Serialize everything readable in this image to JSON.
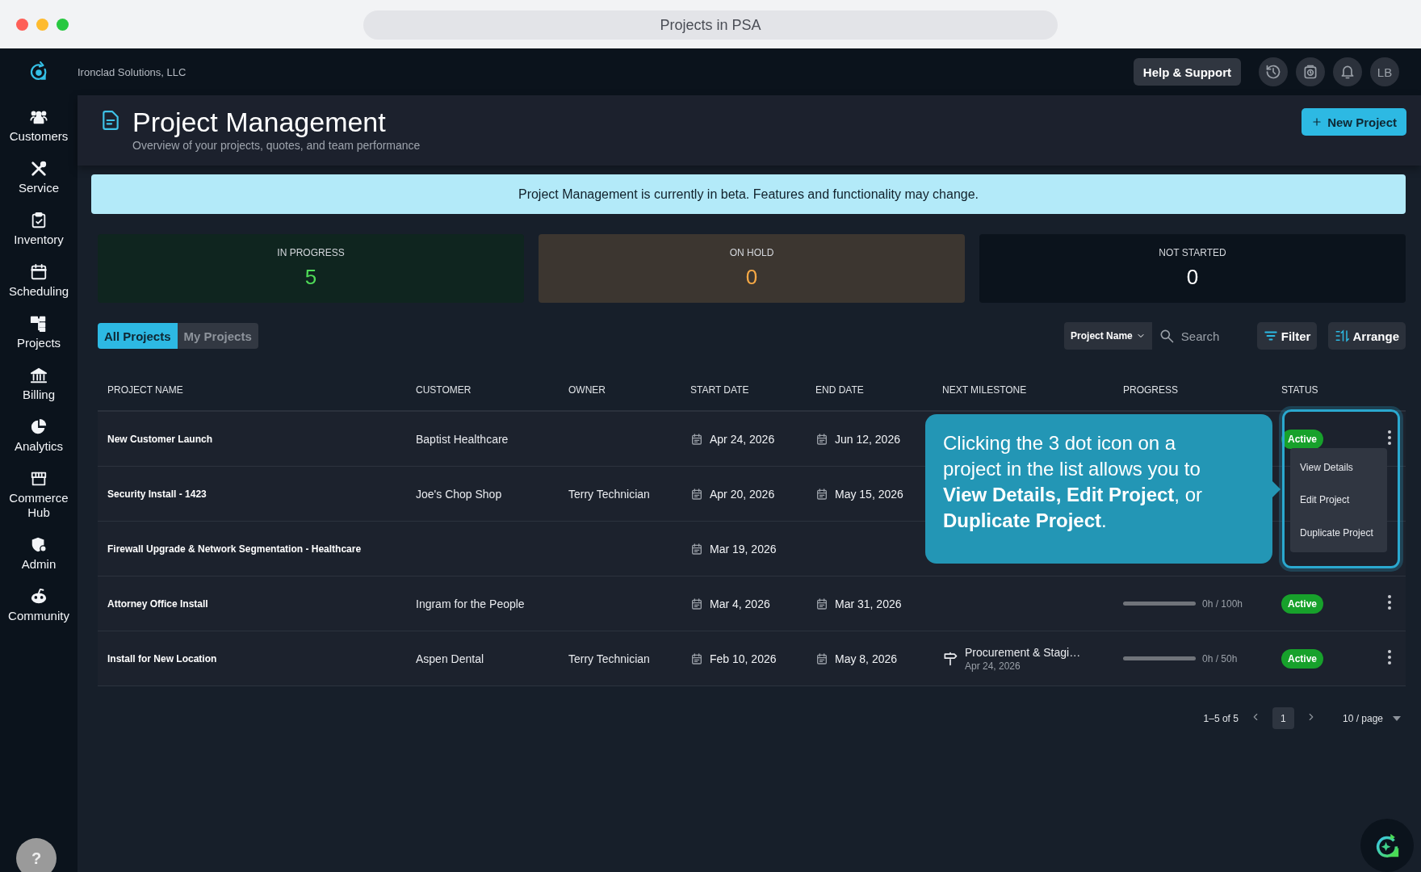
{
  "window": {
    "title": "Projects in PSA"
  },
  "company": "Ironclad Solutions, LLC",
  "top_actions": {
    "help": "Help & Support",
    "avatar": "LB"
  },
  "sidebar": {
    "items": [
      {
        "label": "Customers",
        "selected": false
      },
      {
        "label": "Service",
        "selected": false
      },
      {
        "label": "Inventory",
        "selected": false
      },
      {
        "label": "Scheduling",
        "selected": false
      },
      {
        "label": "Projects",
        "selected": false
      },
      {
        "label": "Billing",
        "selected": false
      },
      {
        "label": "Analytics",
        "selected": false
      },
      {
        "label": "Commerce Hub",
        "selected": false
      },
      {
        "label": "Admin",
        "selected": false
      },
      {
        "label": "Community",
        "selected": false
      }
    ]
  },
  "header": {
    "title": "Project Management",
    "subtitle": "Overview of your projects, quotes, and team performance",
    "new_button": "New Project"
  },
  "banner": "Project Management is currently in beta. Features and functionality may change.",
  "stats": [
    {
      "kind": "progress",
      "label": "IN PROGRESS",
      "value": "5"
    },
    {
      "kind": "hold",
      "label": "ON HOLD",
      "value": "0"
    },
    {
      "kind": "idle",
      "label": "NOT STARTED",
      "value": "0"
    }
  ],
  "tabs": [
    {
      "label": "All Projects",
      "selected": true
    },
    {
      "label": "My Projects",
      "selected": false
    }
  ],
  "toolbar": {
    "field_select": "Project Name",
    "search_placeholder": "Search",
    "filter": "Filter",
    "arrange": "Arrange"
  },
  "table": {
    "columns": [
      "PROJECT NAME",
      "CUSTOMER",
      "OWNER",
      "START DATE",
      "END DATE",
      "NEXT MILESTONE",
      "PROGRESS",
      "STATUS"
    ],
    "rows": [
      {
        "name": "New Customer Launch",
        "customer": "Baptist Healthcare",
        "start": "Apr 24, 2026",
        "end": "Jun 12, 2026",
        "status": "Active"
      },
      {
        "name": "Security Install - 1423",
        "customer": "Joe's Chop Shop",
        "owner": "Terry Technician",
        "start": "Apr 20, 2026",
        "end": "May 15, 2026"
      },
      {
        "name": "Firewall Upgrade & Network Segmentation - Healthcare",
        "start": "Mar 19, 2026"
      },
      {
        "name": "Attorney Office Install",
        "customer": "Ingram for the People",
        "start": "Mar 4, 2026",
        "end": "Mar 31, 2026",
        "progress": {
          "level": 0,
          "reading": "0h / 100h"
        },
        "status": "Active"
      },
      {
        "name": "Install for New Location",
        "customer": "Aspen Dental",
        "owner": "Terry Technician",
        "start": "Feb 10, 2026",
        "end": "May 8, 2026",
        "milestone": {
          "title": "Procurement & Stagi…",
          "date": "Apr 24, 2026"
        },
        "progress": {
          "level": 0,
          "reading": "0h / 50h"
        },
        "status": "Active"
      }
    ]
  },
  "tooltip": "Clicking the 3 dot icon on a project in the list allows you to **View Details, Edit Project**, or **Duplicate Project**.",
  "row_menu": {
    "items": [
      "View Details",
      "Edit Project",
      "Duplicate Project"
    ]
  },
  "pagination": {
    "range": "1–5 of 5",
    "pages": [
      {
        "label": "1",
        "selected": true
      }
    ],
    "page_size": "10 / page"
  },
  "help_button": "?"
}
